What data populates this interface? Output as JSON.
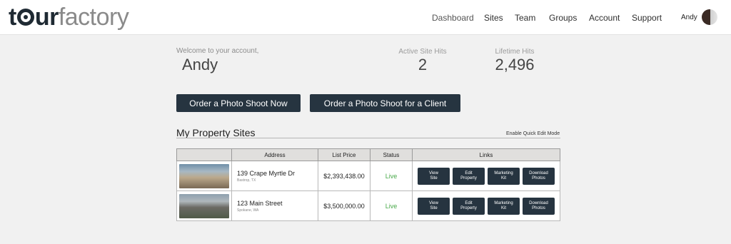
{
  "brand": {
    "part1": "t",
    "part1b": "ur",
    "part2": "factory"
  },
  "nav": [
    {
      "label": "Dashboard",
      "name": "nav-dashboard"
    },
    {
      "label": "Sites",
      "name": "nav-sites"
    },
    {
      "label": "Team",
      "name": "nav-team"
    },
    {
      "label": "Groups",
      "name": "nav-groups"
    },
    {
      "label": "Account",
      "name": "nav-account"
    },
    {
      "label": "Support",
      "name": "nav-support"
    }
  ],
  "user": {
    "name": "Andy"
  },
  "welcome": {
    "label": "Welcome to your account,",
    "name": "Andy"
  },
  "stats": {
    "active_label": "Active Site Hits",
    "active_value": "2",
    "lifetime_label": "Lifetime Hits",
    "lifetime_value": "2,496"
  },
  "actions": {
    "order_now": "Order a Photo Shoot Now",
    "order_client": "Order a Photo Shoot for a Client"
  },
  "properties": {
    "title": "My Property Sites",
    "quick_edit": "Enable Quick Edit Mode",
    "columns": [
      "",
      "Address",
      "List Price",
      "Status",
      "Links"
    ],
    "rows": [
      {
        "address": "139 Crape Myrtle Dr",
        "city": "Bastrop, TX",
        "price": "$2,393,438.00",
        "status": "Live"
      },
      {
        "address": "123 Main Street",
        "city": "Spokane, WA",
        "price": "$3,500,000.00",
        "status": "Live"
      }
    ],
    "link_labels": {
      "view": "View\nSite",
      "edit": "Edit\nProperty",
      "marketing": "Marketing\nKit",
      "download": "Download\nPhotos"
    }
  },
  "colors": {
    "dark_button": "#263440",
    "live": "#49a94a",
    "header_bg": "#e0dfdd"
  }
}
